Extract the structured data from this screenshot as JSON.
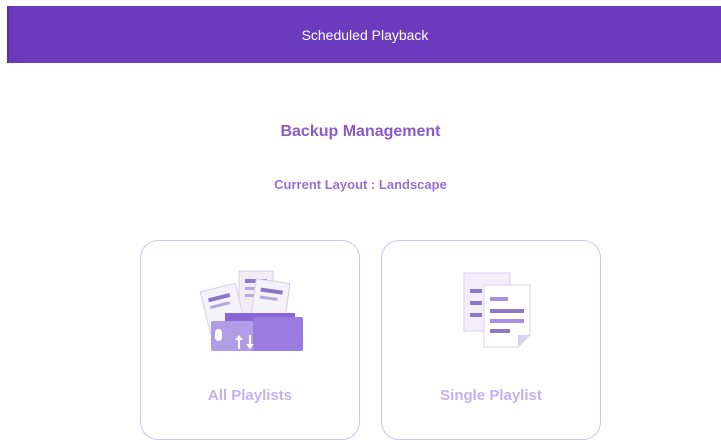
{
  "header": {
    "title": "Scheduled Playback"
  },
  "main": {
    "title": "Backup Management",
    "current_layout_label": "Current Layout : Landscape"
  },
  "cards": [
    {
      "label": "All Playlists",
      "icon": "folder-files-transfer-icon"
    },
    {
      "label": "Single Playlist",
      "icon": "documents-icon"
    }
  ],
  "colors": {
    "header_bg": "#6c3bbd",
    "accent": "#8b5bc8",
    "card_border": "#d2c6ef",
    "card_label": "#c3b3ec"
  }
}
